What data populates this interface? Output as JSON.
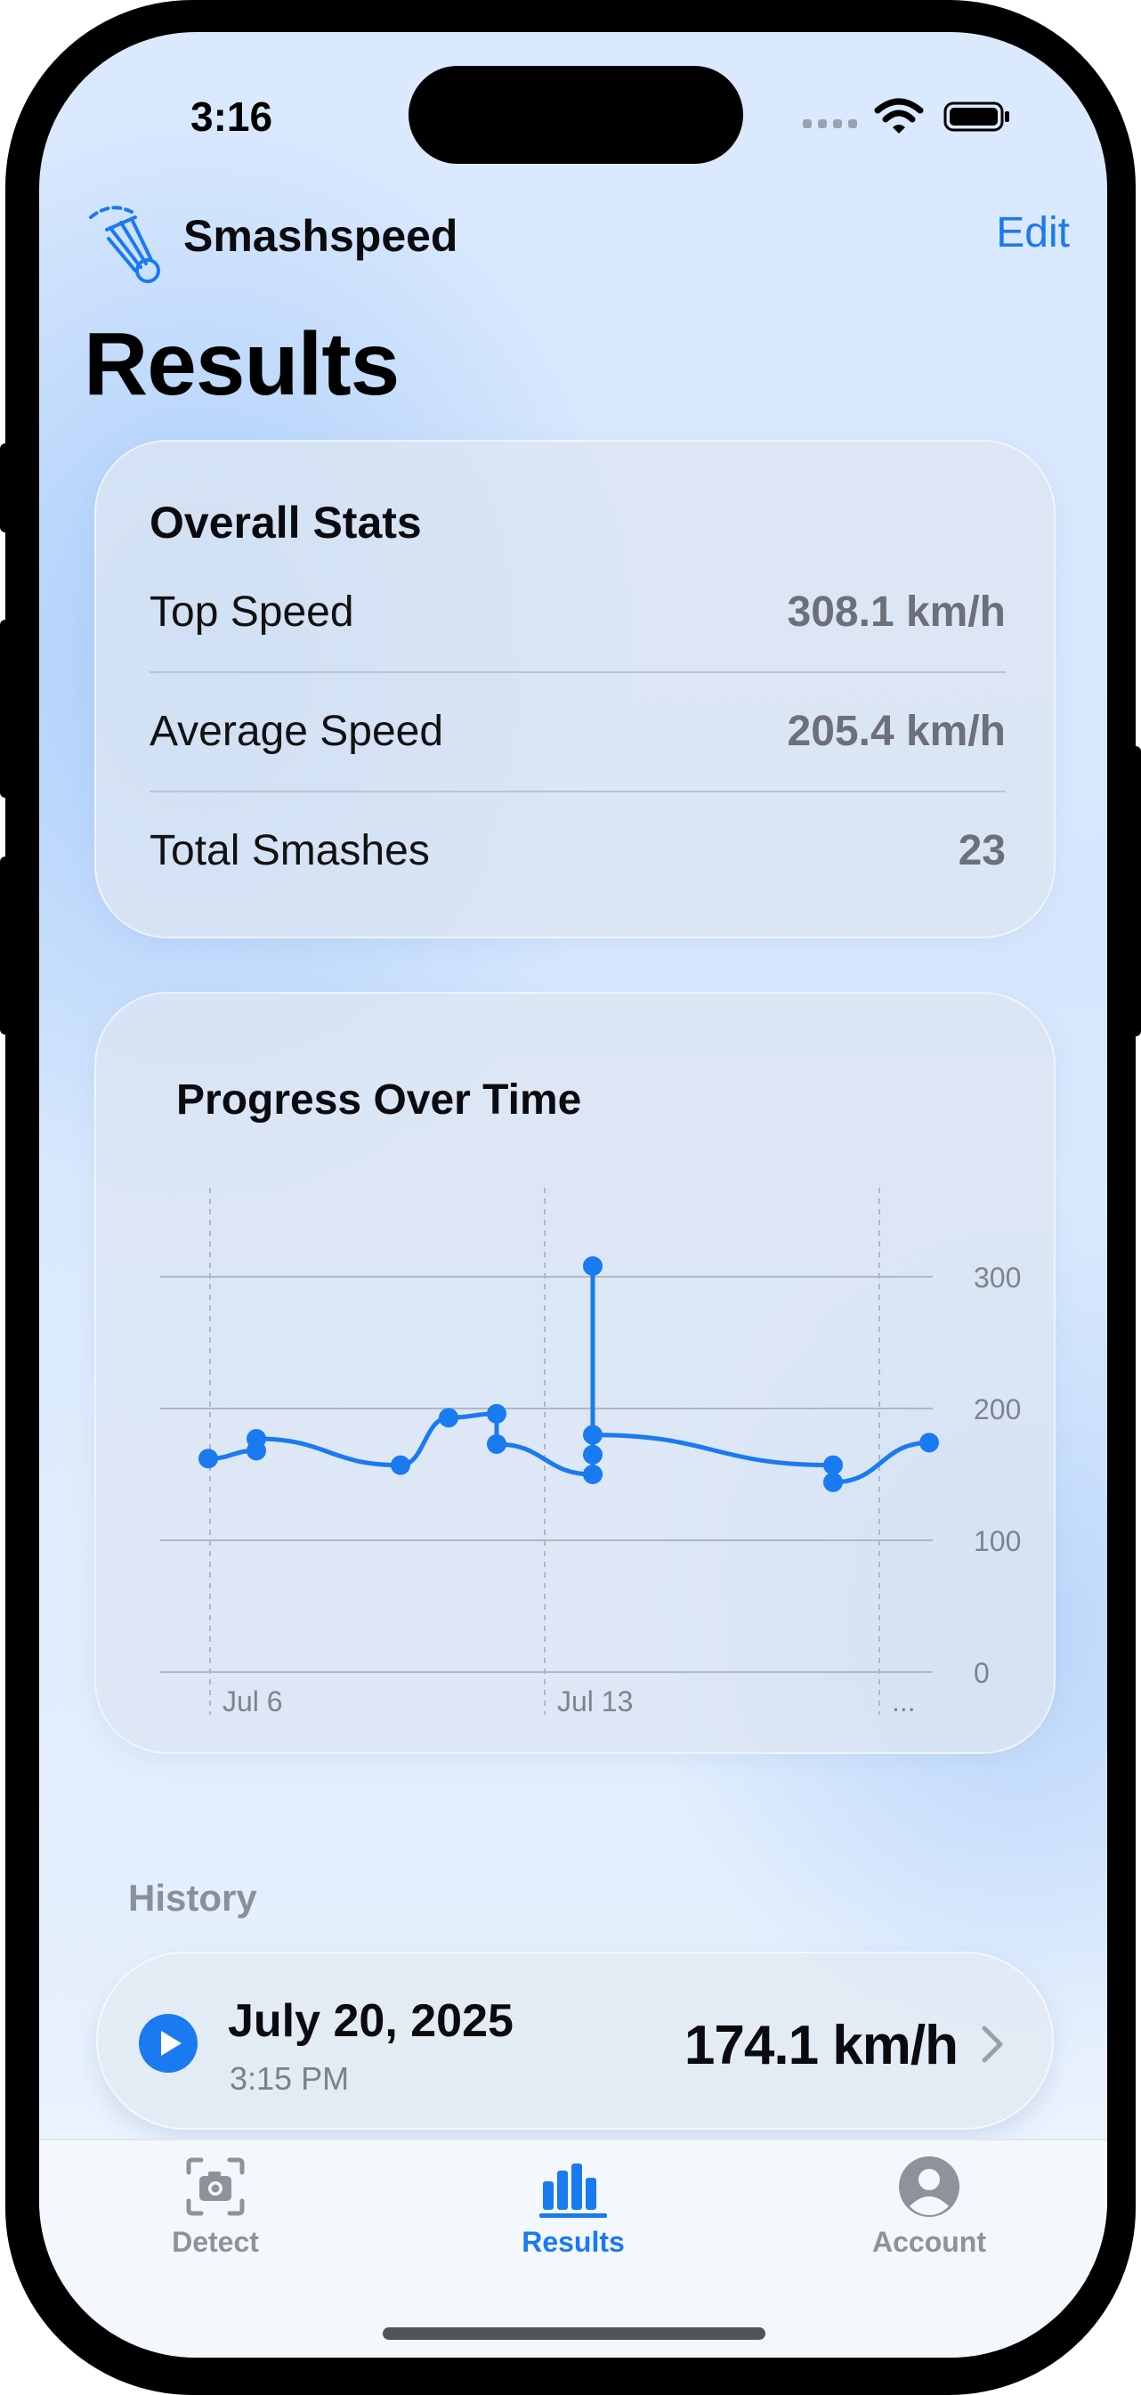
{
  "status_bar": {
    "time": "3:16"
  },
  "header": {
    "app_name": "Smashspeed",
    "edit_label": "Edit"
  },
  "page_title": "Results",
  "overall_stats": {
    "heading": "Overall Stats",
    "rows": [
      {
        "label": "Top Speed",
        "value": "308.1 km/h"
      },
      {
        "label": "Average Speed",
        "value": "205.4 km/h"
      },
      {
        "label": "Total Smashes",
        "value": "23"
      }
    ]
  },
  "progress_chart": {
    "title": "Progress Over Time"
  },
  "chart_data": {
    "type": "line",
    "title": "Progress Over Time",
    "xlabel": "",
    "ylabel": "",
    "x_tick_labels": [
      "Jul 6",
      "Jul 13",
      "..."
    ],
    "y_ticks": [
      0,
      100,
      200,
      300
    ],
    "ylim": [
      0,
      340
    ],
    "grid": true,
    "y_axis_position": "right",
    "series": [
      {
        "color": "#1a7af0",
        "points": [
          {
            "x": "Jul 5",
            "y": 162
          },
          {
            "x": "Jul 6",
            "y": 168
          },
          {
            "x": "Jul 6",
            "y": 177
          },
          {
            "x": "Jul 9",
            "y": 157
          },
          {
            "x": "Jul 10",
            "y": 193
          },
          {
            "x": "Jul 11",
            "y": 196
          },
          {
            "x": "Jul 11",
            "y": 173
          },
          {
            "x": "Jul 13",
            "y": 150
          },
          {
            "x": "Jul 13",
            "y": 308.1
          },
          {
            "x": "Jul 13",
            "y": 165
          },
          {
            "x": "Jul 13",
            "y": 180
          },
          {
            "x": "Jul 18",
            "y": 157
          },
          {
            "x": "Jul 18",
            "y": 144
          },
          {
            "x": "Jul 20",
            "y": 174.1
          }
        ]
      }
    ]
  },
  "history": {
    "label": "History",
    "items": [
      {
        "date": "July 20, 2025",
        "time": "3:15 PM",
        "speed": "174.1 km/h"
      }
    ]
  },
  "tabbar": {
    "tabs": [
      {
        "label": "Detect",
        "icon": "camera-icon",
        "active": false
      },
      {
        "label": "Results",
        "icon": "bar-chart-icon",
        "active": true
      },
      {
        "label": "Account",
        "icon": "person-circle-icon",
        "active": false
      }
    ]
  },
  "colors": {
    "accent": "#1a7af0",
    "secondary_text": "#6d7079"
  }
}
